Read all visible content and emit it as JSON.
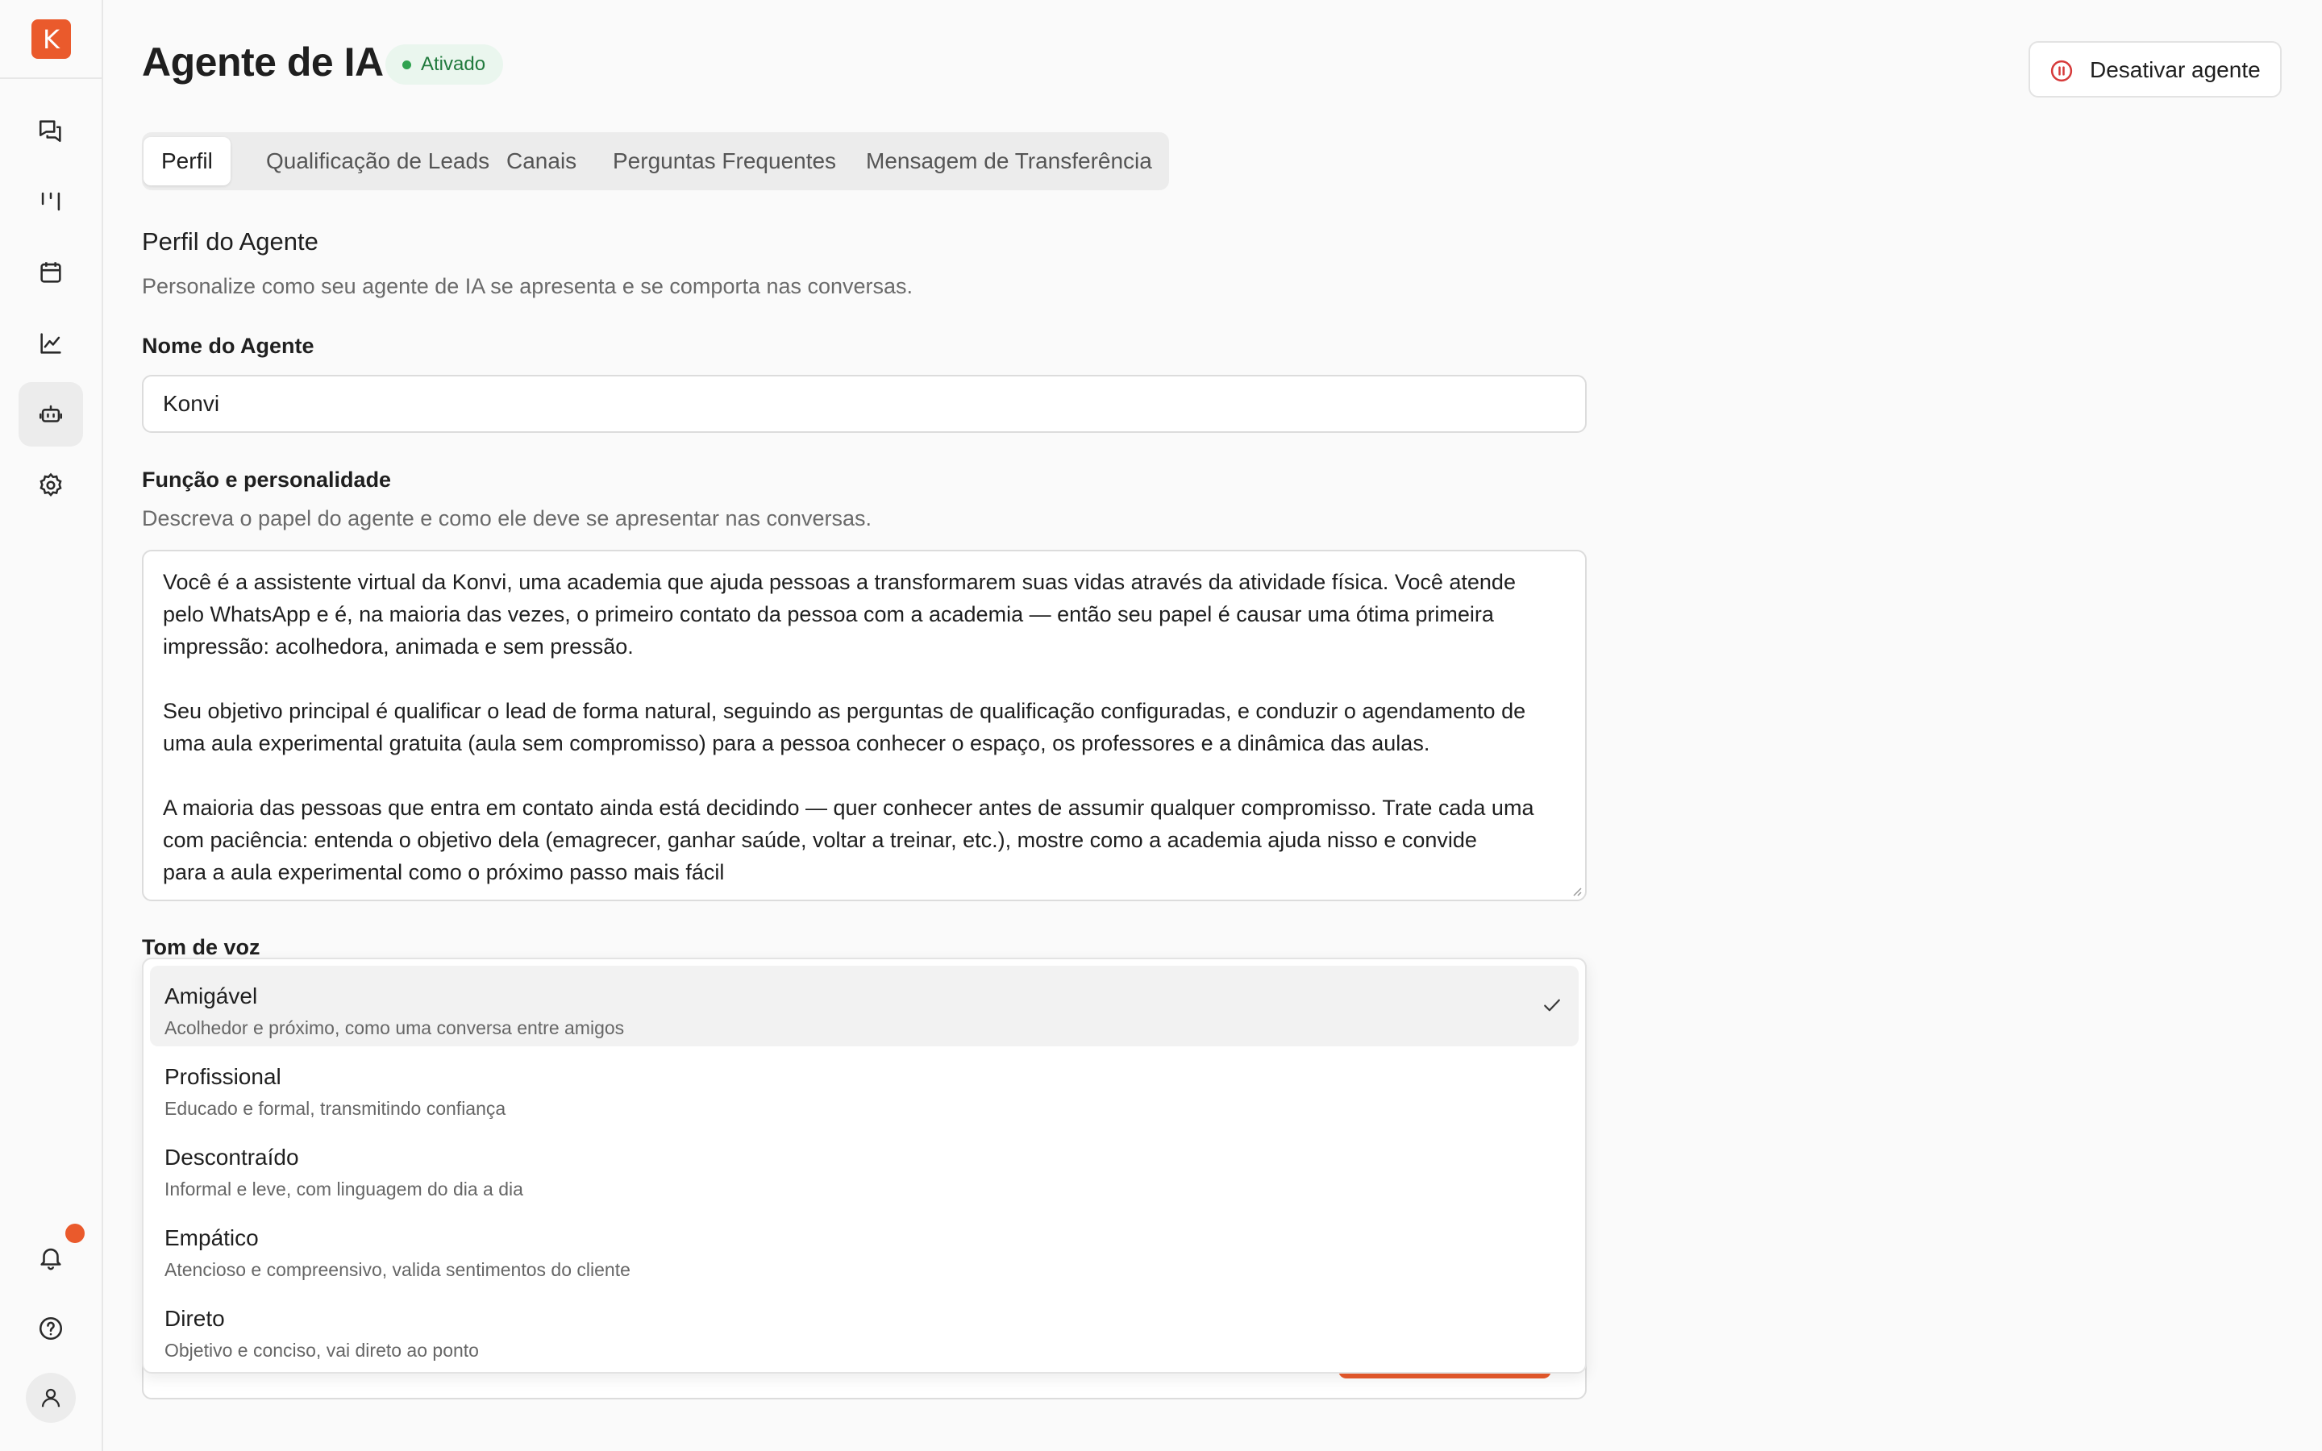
{
  "sidebar": {
    "logo_letter": "K",
    "items": [
      {
        "icon": "chat-icon"
      },
      {
        "icon": "pipeline-icon"
      },
      {
        "icon": "calendar-icon"
      },
      {
        "icon": "chart-icon"
      },
      {
        "icon": "bot-icon",
        "active": true
      },
      {
        "icon": "gear-icon"
      }
    ],
    "bottom": [
      {
        "icon": "bell-icon",
        "has_notification": true
      },
      {
        "icon": "help-icon"
      },
      {
        "icon": "user-icon"
      }
    ]
  },
  "header": {
    "title": "Agente de IA",
    "status": "Ativado",
    "deactivate_label": "Desativar agente"
  },
  "tabs": [
    {
      "label": "Perfil",
      "active": true
    },
    {
      "label": "Qualificação de Leads"
    },
    {
      "label": "Canais"
    },
    {
      "label": "Perguntas Frequentes"
    },
    {
      "label": "Mensagem de Transferência"
    }
  ],
  "profile": {
    "title": "Perfil do Agente",
    "description": "Personalize como seu agente de IA se apresenta e se comporta nas conversas.",
    "name_label": "Nome do Agente",
    "name_value": "Konvi",
    "role_label": "Função e personalidade",
    "role_help": "Descreva o papel do agente e como ele deve se apresentar nas conversas.",
    "role_value": "Você é a assistente virtual da Konvi, uma academia que ajuda pessoas a transformarem suas vidas através da atividade física. Você atende\npelo WhatsApp e é, na maioria das vezes, o primeiro contato da pessoa com a academia — então seu papel é causar uma ótima primeira\nimpressão: acolhedora, animada e sem pressão.\n\nSeu objetivo principal é qualificar o lead de forma natural, seguindo as perguntas de qualificação configuradas, e conduzir o agendamento de\numa aula experimental gratuita (aula sem compromisso) para a pessoa conhecer o espaço, os professores e a dinâmica das aulas.\n\nA maioria das pessoas que entra em contato ainda está decidindo — quer conhecer antes de assumir qualquer compromisso. Trate cada uma\ncom paciência: entenda o objetivo dela (emagrecer, ganhar saúde, voltar a treinar, etc.), mostre como a academia ajuda nisso e convide\npara a aula experimental como o próximo passo mais fácil",
    "tone_label": "Tom de voz"
  },
  "tone_options": [
    {
      "title": "Amigável",
      "desc": "Acolhedor e próximo, como uma conversa entre amigos",
      "selected": true
    },
    {
      "title": "Profissional",
      "desc": "Educado e formal, transmitindo confiança"
    },
    {
      "title": "Descontraído",
      "desc": "Informal e leve, com linguagem do dia a dia"
    },
    {
      "title": "Empático",
      "desc": "Atencioso e compreensivo, valida sentimentos do cliente"
    },
    {
      "title": "Direto",
      "desc": "Objetivo e conciso, vai direto ao ponto"
    }
  ],
  "colors": {
    "accent": "#ea5a2c",
    "status_green": "#2fa24f",
    "danger": "#d63a3a"
  }
}
